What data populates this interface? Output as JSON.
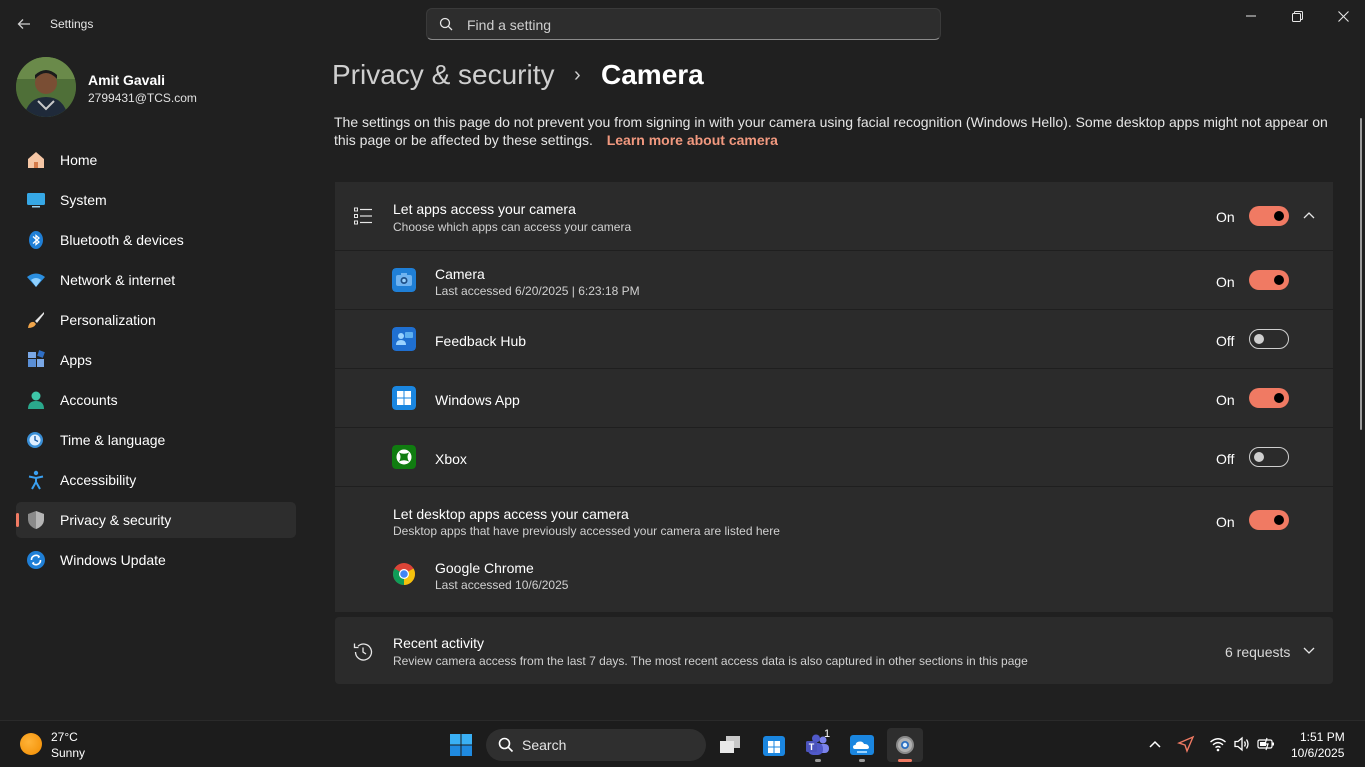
{
  "window": {
    "app_title": "Settings",
    "search_placeholder": "Find a setting"
  },
  "user": {
    "name": "Amit Gavali",
    "email": "2799431@TCS.com"
  },
  "nav": {
    "items": [
      {
        "label": "Home",
        "icon": "home-icon"
      },
      {
        "label": "System",
        "icon": "system-icon"
      },
      {
        "label": "Bluetooth & devices",
        "icon": "bluetooth-icon"
      },
      {
        "label": "Network & internet",
        "icon": "wifi-icon"
      },
      {
        "label": "Personalization",
        "icon": "brush-icon"
      },
      {
        "label": "Apps",
        "icon": "apps-icon"
      },
      {
        "label": "Accounts",
        "icon": "account-icon"
      },
      {
        "label": "Time & language",
        "icon": "clock-globe-icon"
      },
      {
        "label": "Accessibility",
        "icon": "accessibility-icon"
      },
      {
        "label": "Privacy & security",
        "icon": "shield-icon",
        "active": true
      },
      {
        "label": "Windows Update",
        "icon": "update-icon"
      }
    ]
  },
  "page": {
    "breadcrumb_parent": "Privacy & security",
    "breadcrumb_sep": "›",
    "title": "Camera",
    "info_text": "The settings on this page do not prevent you from signing in with your camera using facial recognition (Windows Hello). Some desktop apps might not appear on this page or be affected by these settings.",
    "info_link": "Learn more about camera"
  },
  "main_toggle": {
    "title": "Let apps access your camera",
    "subtitle": "Choose which apps can access your camera",
    "state": "On"
  },
  "apps": [
    {
      "name": "Camera",
      "last": "Last accessed 6/20/2025  |  6:23:18 PM",
      "state": "On"
    },
    {
      "name": "Feedback Hub",
      "state": "Off"
    },
    {
      "name": "Windows App",
      "state": "On"
    },
    {
      "name": "Xbox",
      "state": "Off"
    }
  ],
  "desktop_toggle": {
    "title": "Let desktop apps access your camera",
    "subtitle": "Desktop apps that have previously accessed your camera are listed here",
    "state": "On",
    "app_name": "Google Chrome",
    "app_last": "Last accessed 10/6/2025"
  },
  "recent": {
    "title": "Recent activity",
    "subtitle": "Review camera access from the last 7 days. The most recent access data is also captured in other sections in this page",
    "count": "6 requests"
  },
  "taskbar": {
    "temp": "27°C",
    "condition": "Sunny",
    "search_label": "Search",
    "teams_badge": "1",
    "time": "1:51 PM",
    "date": "10/6/2025"
  },
  "colors": {
    "accent": "#f07a63",
    "link": "#f2997f",
    "background": "#202020",
    "card": "#2b2b2b"
  }
}
